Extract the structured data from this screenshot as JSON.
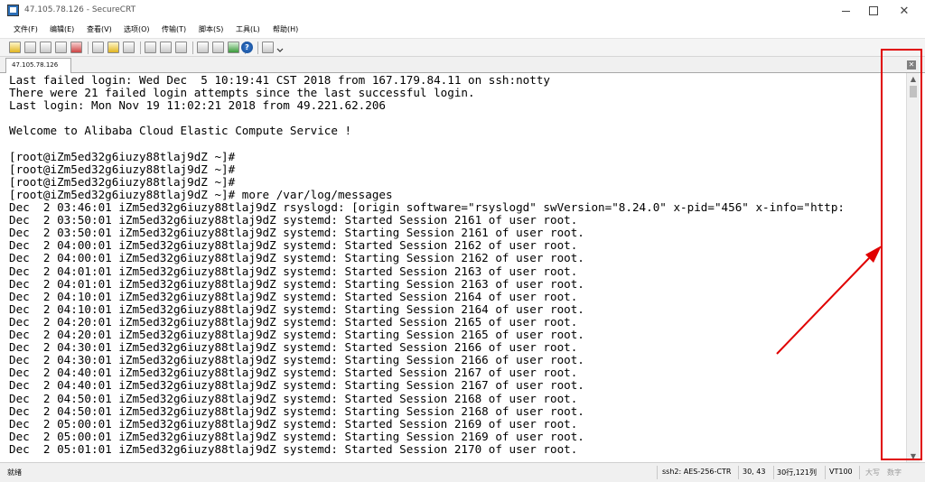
{
  "window": {
    "title": "47.105.78.126 - SecureCRT",
    "close_glyph": "✕"
  },
  "menu": [
    "文件(F)",
    "编辑(E)",
    "查看(V)",
    "选项(O)",
    "传输(T)",
    "脚本(S)",
    "工具(L)",
    "帮助(H)"
  ],
  "toolbar": {
    "help_glyph": "?"
  },
  "tabs": [
    {
      "label": "47.105.78.126"
    }
  ],
  "tab_close_glyph": "✕",
  "terminal": {
    "lines": [
      "Last failed login: Wed Dec  5 10:19:41 CST 2018 from 167.179.84.11 on ssh:notty",
      "There were 21 failed login attempts since the last successful login.",
      "Last login: Mon Nov 19 11:02:21 2018 from 49.221.62.206",
      "",
      "Welcome to Alibaba Cloud Elastic Compute Service !",
      "",
      "[root@iZm5ed32g6iuzy88tlaj9dZ ~]#",
      "[root@iZm5ed32g6iuzy88tlaj9dZ ~]#",
      "[root@iZm5ed32g6iuzy88tlaj9dZ ~]#",
      "[root@iZm5ed32g6iuzy88tlaj9dZ ~]# more /var/log/messages",
      "Dec  2 03:46:01 iZm5ed32g6iuzy88tlaj9dZ rsyslogd: [origin software=\"rsyslogd\" swVersion=\"8.24.0\" x-pid=\"456\" x-info=\"http:",
      "Dec  2 03:50:01 iZm5ed32g6iuzy88tlaj9dZ systemd: Started Session 2161 of user root.",
      "Dec  2 03:50:01 iZm5ed32g6iuzy88tlaj9dZ systemd: Starting Session 2161 of user root.",
      "Dec  2 04:00:01 iZm5ed32g6iuzy88tlaj9dZ systemd: Started Session 2162 of user root.",
      "Dec  2 04:00:01 iZm5ed32g6iuzy88tlaj9dZ systemd: Starting Session 2162 of user root.",
      "Dec  2 04:01:01 iZm5ed32g6iuzy88tlaj9dZ systemd: Started Session 2163 of user root.",
      "Dec  2 04:01:01 iZm5ed32g6iuzy88tlaj9dZ systemd: Starting Session 2163 of user root.",
      "Dec  2 04:10:01 iZm5ed32g6iuzy88tlaj9dZ systemd: Started Session 2164 of user root.",
      "Dec  2 04:10:01 iZm5ed32g6iuzy88tlaj9dZ systemd: Starting Session 2164 of user root.",
      "Dec  2 04:20:01 iZm5ed32g6iuzy88tlaj9dZ systemd: Started Session 2165 of user root.",
      "Dec  2 04:20:01 iZm5ed32g6iuzy88tlaj9dZ systemd: Starting Session 2165 of user root.",
      "Dec  2 04:30:01 iZm5ed32g6iuzy88tlaj9dZ systemd: Started Session 2166 of user root.",
      "Dec  2 04:30:01 iZm5ed32g6iuzy88tlaj9dZ systemd: Starting Session 2166 of user root.",
      "Dec  2 04:40:01 iZm5ed32g6iuzy88tlaj9dZ systemd: Started Session 2167 of user root.",
      "Dec  2 04:40:01 iZm5ed32g6iuzy88tlaj9dZ systemd: Starting Session 2167 of user root.",
      "Dec  2 04:50:01 iZm5ed32g6iuzy88tlaj9dZ systemd: Started Session 2168 of user root.",
      "Dec  2 04:50:01 iZm5ed32g6iuzy88tlaj9dZ systemd: Starting Session 2168 of user root.",
      "Dec  2 05:00:01 iZm5ed32g6iuzy88tlaj9dZ systemd: Started Session 2169 of user root.",
      "Dec  2 05:00:01 iZm5ed32g6iuzy88tlaj9dZ systemd: Starting Session 2169 of user root.",
      "Dec  2 05:01:01 iZm5ed32g6iuzy88tlaj9dZ systemd: Started Session 2170 of user root."
    ]
  },
  "scrollbar": {
    "up_glyph": "▲",
    "down_glyph": "▼"
  },
  "status": {
    "ready": "就绪",
    "cipher": "ssh2: AES-256-CTR",
    "cursor": "30,  43",
    "size": "30行,121列",
    "term": "VT100",
    "caps": "大写",
    "num": "数字"
  },
  "annotation": {
    "color": "#e00000"
  }
}
